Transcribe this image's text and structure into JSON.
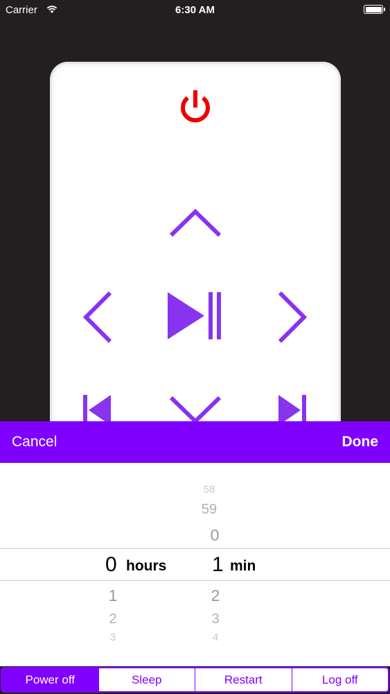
{
  "status_bar": {
    "carrier": "Carrier",
    "time": "6:30 AM"
  },
  "colors": {
    "accent": "#8000ff",
    "power": "#ee0000",
    "background": "#231f20"
  },
  "remote": {
    "buttons": [
      "power-icon",
      "up-arrow-icon",
      "left-arrow-icon",
      "play-pause-icon",
      "right-arrow-icon",
      "previous-track-icon",
      "down-arrow-icon",
      "next-track-icon"
    ]
  },
  "toolbar": {
    "cancel_label": "Cancel",
    "done_label": "Done"
  },
  "picker": {
    "hours": {
      "above": [],
      "selected": "0",
      "below": [
        "1",
        "2",
        "3"
      ],
      "unit": "hours"
    },
    "minutes": {
      "above": [
        "58",
        "59",
        "0"
      ],
      "selected": "1",
      "below": [
        "2",
        "3",
        "4"
      ],
      "unit": "min"
    }
  },
  "segments": {
    "items": [
      "Power off",
      "Sleep",
      "Restart",
      "Log off"
    ],
    "selected": "Power off"
  }
}
